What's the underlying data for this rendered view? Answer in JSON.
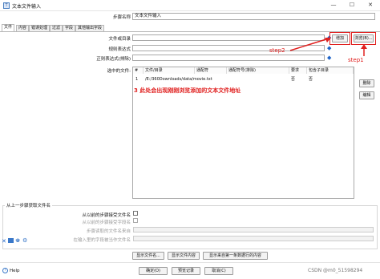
{
  "window": {
    "title": "文本文件输入",
    "minimize": "—",
    "maximize": "☐",
    "close": "✕"
  },
  "step_name": {
    "label": "步骤名称",
    "value": "文本文件输入"
  },
  "tabs": [
    "文件",
    "内容",
    "错误处理",
    "过滤",
    "字段",
    "其他输出字段"
  ],
  "file": {
    "file_or_dir_label": "文件或目录",
    "regex_label": "规则表达式",
    "exclude_regex_label": "正则表达式(排除)",
    "selected_files_label": "选中的文件:",
    "add_button": "增加",
    "browse_button": "浏览(B)..."
  },
  "table": {
    "headers": [
      "#",
      "文件/目录",
      "通配符",
      "通配符号(排除)",
      "要求",
      "包含子目录"
    ],
    "rows": [
      [
        "1",
        "/E:/360Downloads/data/movie.txt",
        "",
        "",
        "否",
        "否"
      ]
    ]
  },
  "side_buttons": {
    "delete": "删除",
    "edit": "编辑"
  },
  "annotations": {
    "step1": "step1",
    "step2": "step2",
    "step3": "3  此处会出现刚刚浏览添加的文本文件地址"
  },
  "prev_step": {
    "section_title": "从上一步骤获取文件名",
    "accept_label": "从以前的步骤接受文件名",
    "accept_field_label": "从以前的步骤接受字段名",
    "read_step_label": "步骤读取的文件名来自",
    "field_in_input_label": "在输入里的字段被当作文件名"
  },
  "bottom_buttons": {
    "show_files": "显示文件名...",
    "show_content": "显示文件内容",
    "show_first_rows": "显示来自第一条数据行的内容"
  },
  "footer_buttons": {
    "ok": "确定(O)",
    "preview": "预览记录",
    "cancel": "取消(C)"
  },
  "help": "Help",
  "watermark": "CSDN @m0_51598294",
  "colors": {
    "annotation": "#e0201f"
  }
}
